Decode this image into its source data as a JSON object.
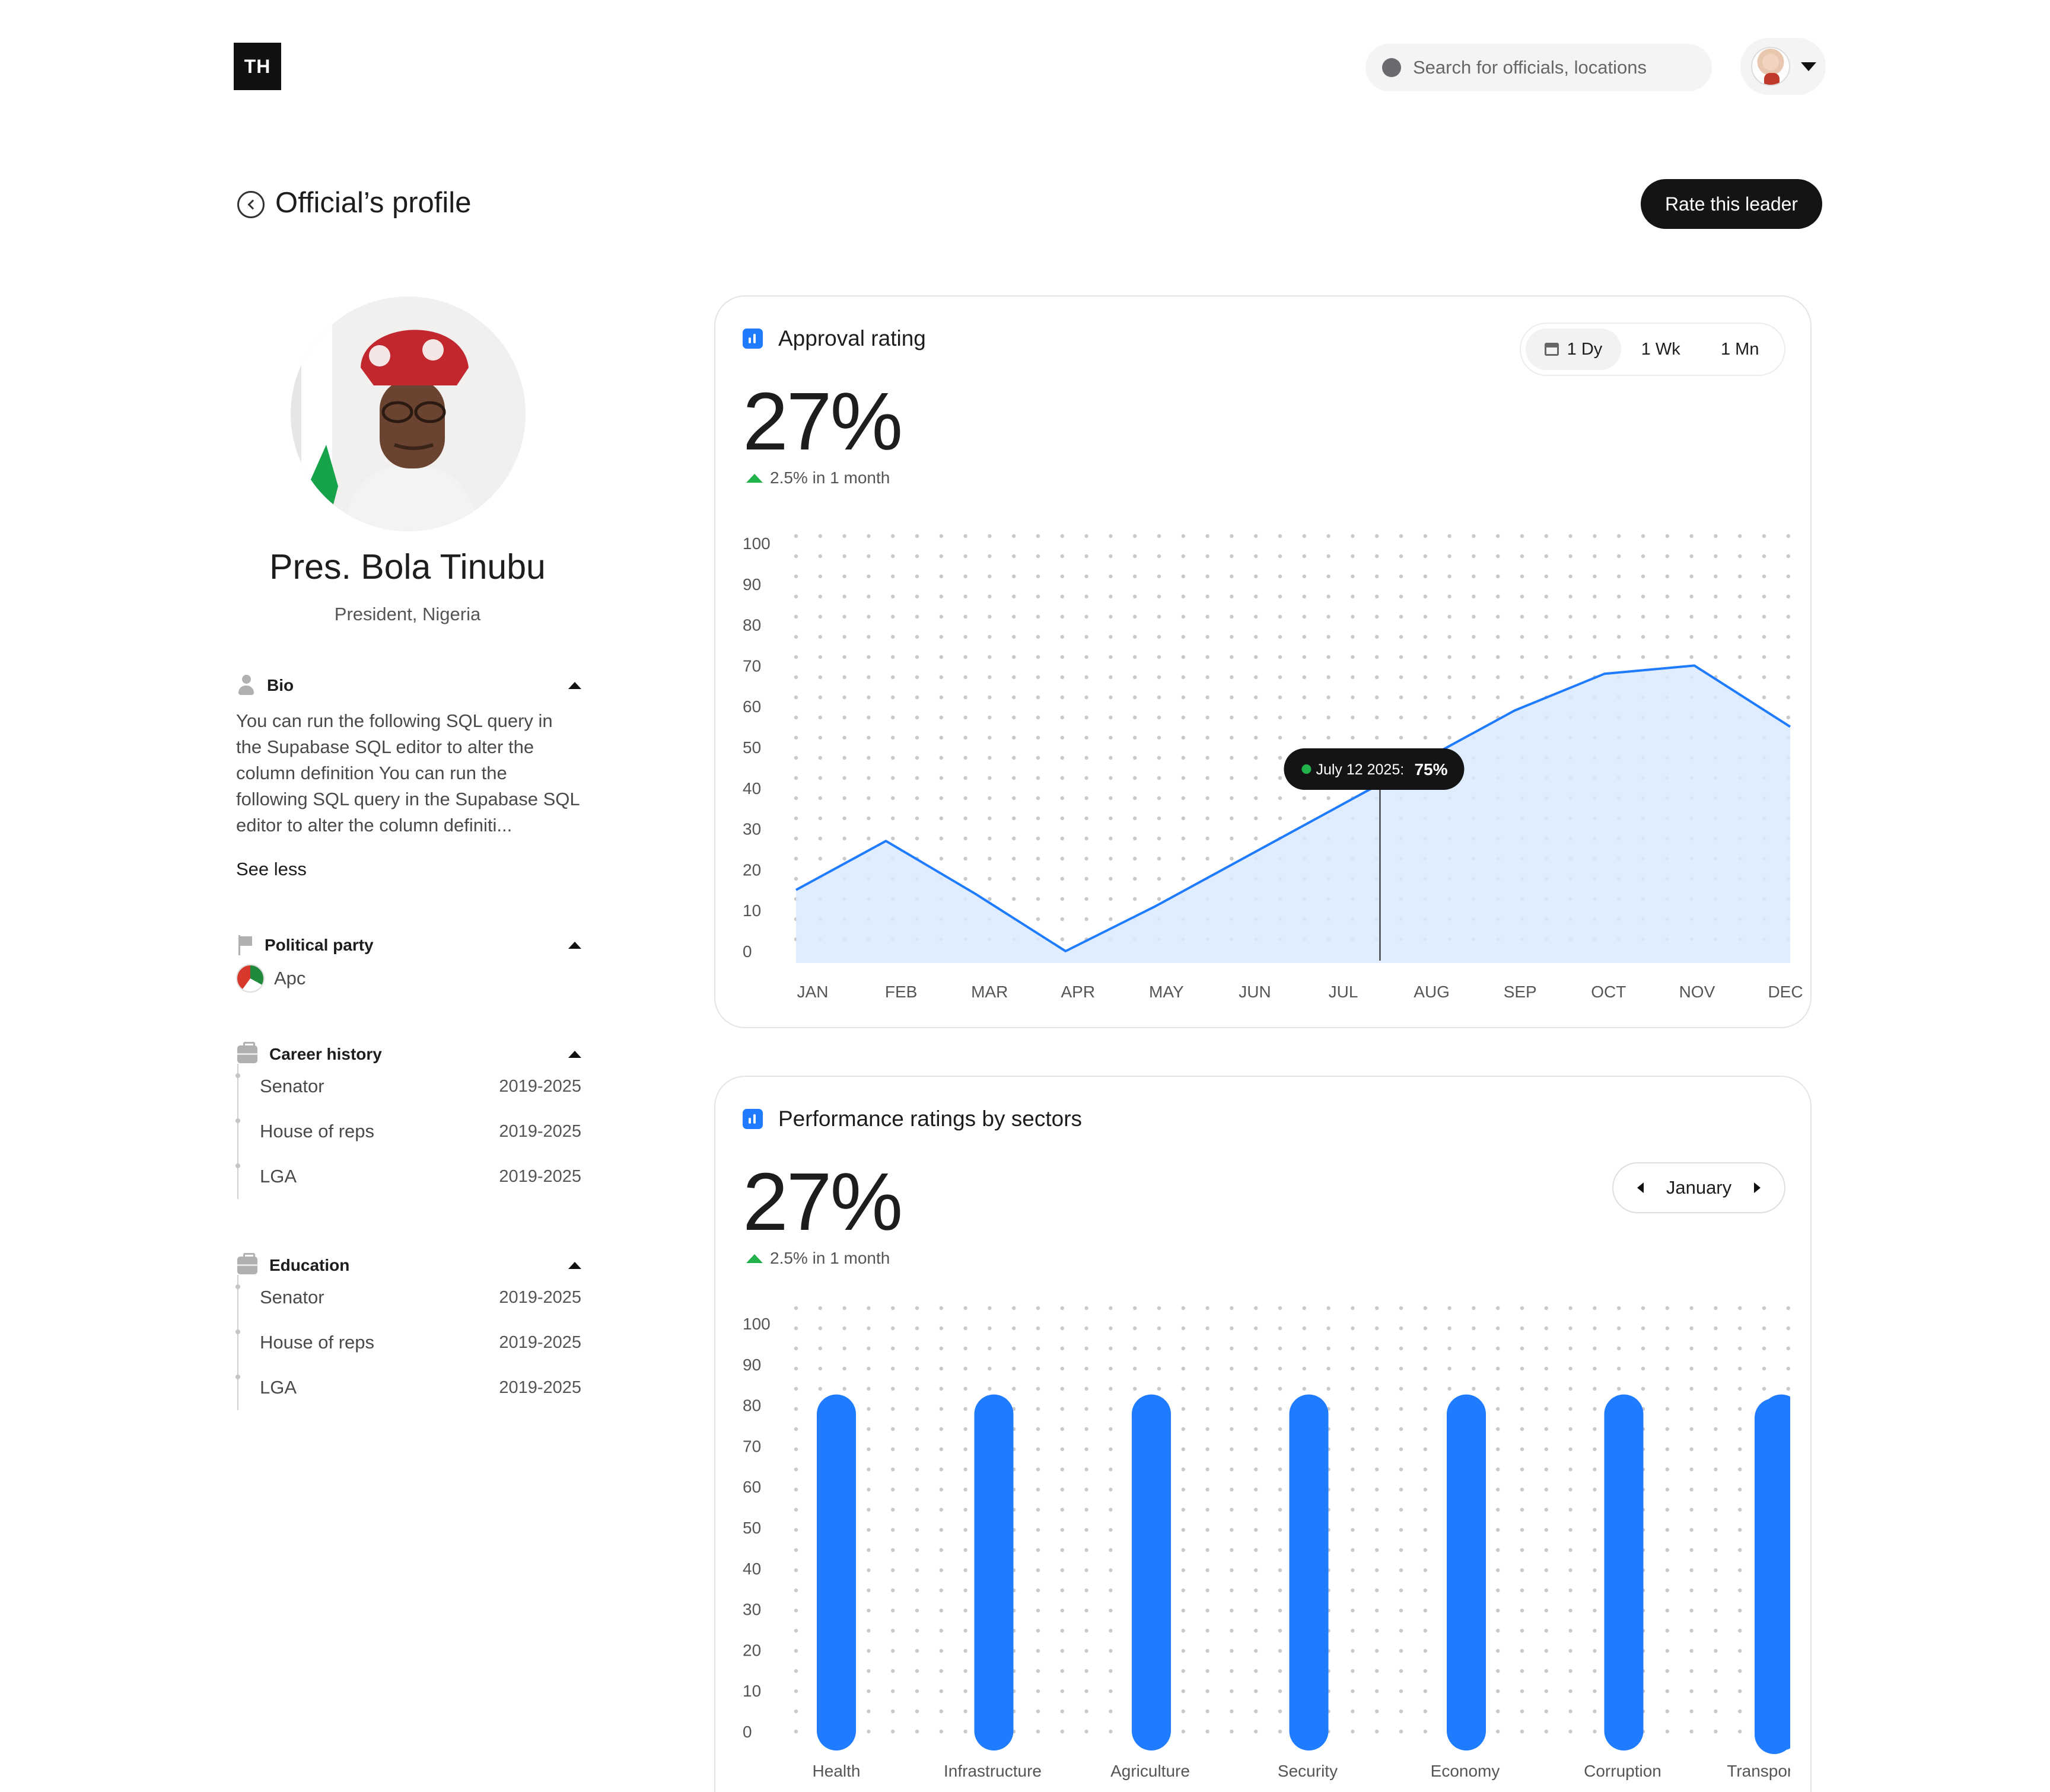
{
  "header": {
    "logo_text": "TH",
    "search_placeholder": "Search for officials, locations"
  },
  "page": {
    "title": "Official’s profile",
    "rate_button": "Rate this leader"
  },
  "profile": {
    "name": "Pres. Bola Tinubu",
    "role": "President, Nigeria"
  },
  "bio": {
    "label": "Bio",
    "text": "You can run the following SQL query in the Supabase SQL editor to alter the column definition You can run the following SQL query in the Supabase SQL editor to alter the column definiti...",
    "toggle": "See less"
  },
  "party": {
    "label": "Political party",
    "name": "Apc",
    "logo_text": "APC"
  },
  "career": {
    "label": "Career history",
    "items": [
      {
        "title": "Senator",
        "years": "2019-2025"
      },
      {
        "title": "House of reps",
        "years": "2019-2025"
      },
      {
        "title": "LGA",
        "years": "2019-2025"
      }
    ]
  },
  "education": {
    "label": "Education",
    "items": [
      {
        "title": "Senator",
        "years": "2019-2025"
      },
      {
        "title": "House of reps",
        "years": "2019-2025"
      },
      {
        "title": "LGA",
        "years": "2019-2025"
      }
    ]
  },
  "approval": {
    "title": "Approval rating",
    "value": "27%",
    "delta": "2.5% in 1 month",
    "ranges": [
      "1 Dy",
      "1 Wk",
      "1 Mn"
    ],
    "active_range": "1 Dy",
    "tooltip_date": "July 12 2025:",
    "tooltip_value": "75%"
  },
  "sectors": {
    "title": "Performance ratings by sectors",
    "value": "27%",
    "delta": "2.5% in 1 month",
    "month": "January"
  },
  "colors": {
    "accent": "#1f7bff",
    "area_fill": "#dbeafe",
    "positive": "#22b24c",
    "dark": "#141414"
  },
  "chart_data": [
    {
      "type": "area",
      "x": [
        "JAN",
        "FEB",
        "MAR",
        "APR",
        "MAY",
        "JUN",
        "JUL",
        "AUG",
        "SEP",
        "OCT",
        "NOV",
        "DEC"
      ],
      "values": [
        15,
        27,
        14,
        0,
        11,
        23,
        35,
        47,
        59,
        68,
        70,
        55
      ],
      "ylim": [
        0,
        100
      ],
      "yticks": [
        0,
        10,
        20,
        30,
        40,
        50,
        60,
        70,
        80,
        90,
        100
      ],
      "grid": "dotted",
      "tooltip_at": 6.5
    },
    {
      "type": "bar",
      "categories": [
        "Health",
        "Infrastructure",
        "Agriculture",
        "Security",
        "Economy",
        "Corruption",
        "Transportation"
      ],
      "values": [
        80,
        80,
        80,
        80,
        80,
        80,
        80
      ],
      "ylim": [
        0,
        100
      ],
      "yticks": [
        0,
        10,
        20,
        30,
        40,
        50,
        60,
        70,
        80,
        90,
        100
      ],
      "grid": "dotted"
    }
  ]
}
